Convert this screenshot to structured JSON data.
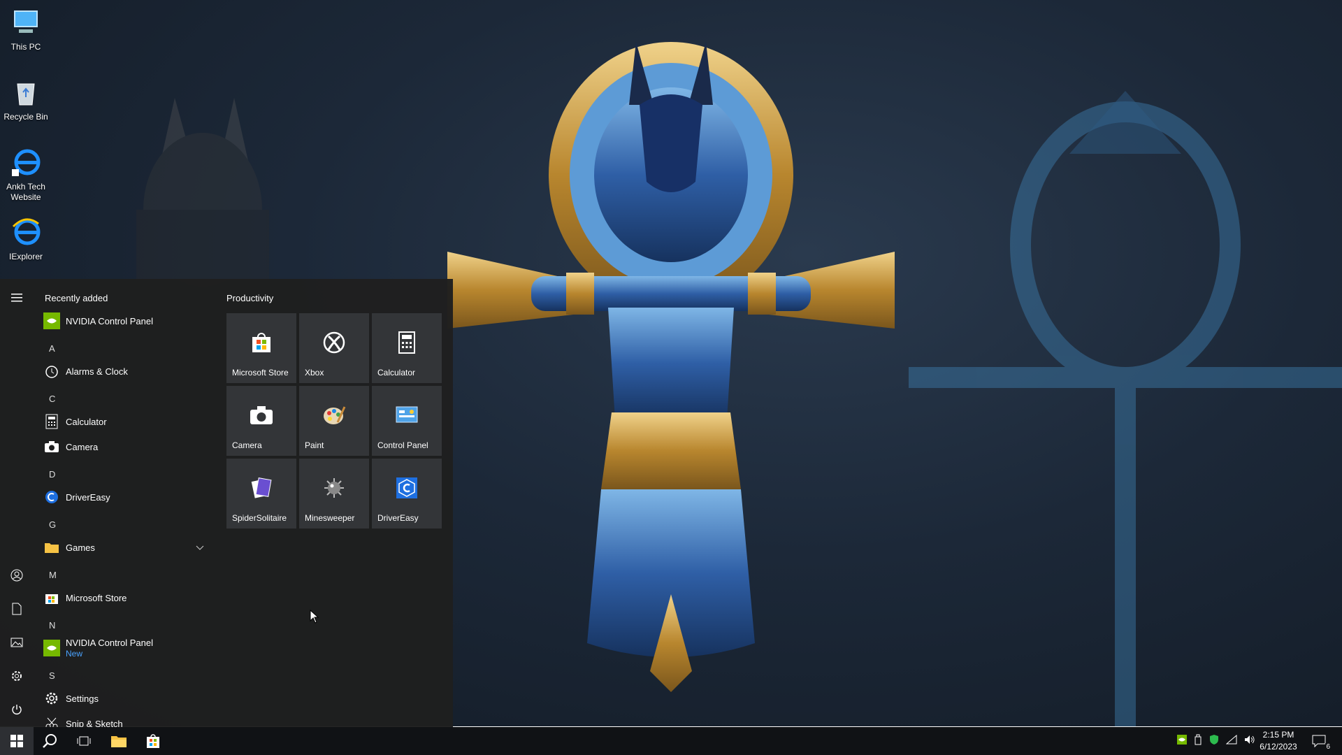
{
  "desktop": {
    "icons": [
      {
        "label": "This PC",
        "icon": "this-pc-icon"
      },
      {
        "label": "Recycle Bin",
        "icon": "recycle-bin-icon"
      },
      {
        "label": "Ankh Tech Website",
        "icon": "ie-shortcut-icon"
      },
      {
        "label": "IExplorer",
        "icon": "ie-icon"
      }
    ]
  },
  "start_menu": {
    "recently_added_header": "Recently added",
    "recent_app": "NVIDIA Control Panel",
    "letters": {
      "a": "A",
      "c": "C",
      "d": "D",
      "g": "G",
      "m": "M",
      "n": "N",
      "s": "S"
    },
    "apps": {
      "alarms": "Alarms & Clock",
      "calculator": "Calculator",
      "camera": "Camera",
      "drivereasy": "DriverEasy",
      "games": "Games",
      "store": "Microsoft Store",
      "nvidia": "NVIDIA Control Panel",
      "nvidia_badge": "New",
      "settings": "Settings",
      "snip": "Snip & Sketch"
    },
    "tile_group": "Productivity",
    "tiles": [
      "Microsoft Store",
      "Xbox",
      "Calculator",
      "Camera",
      "Paint",
      "Control Panel",
      "SpiderSolitaire",
      "Minesweeper",
      "DriverEasy"
    ]
  },
  "taskbar": {
    "time": "2:15 PM",
    "date": "6/12/2023",
    "notification_count": "6"
  },
  "colors": {
    "accent_blue": "#0078d7",
    "nvidia_green": "#76b900",
    "link_blue": "#4aa3ff",
    "taskbar": "#101215",
    "menu": "#1f1f1f",
    "tile": "#333538"
  }
}
